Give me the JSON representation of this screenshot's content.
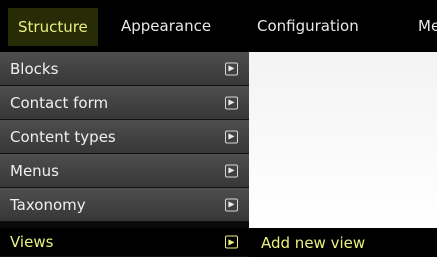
{
  "topnav": {
    "tabs": [
      {
        "label": "Structure"
      },
      {
        "label": "Appearance"
      },
      {
        "label": "Configuration"
      },
      {
        "label": "Me"
      }
    ]
  },
  "structure_menu": {
    "items": [
      {
        "label": "Blocks"
      },
      {
        "label": "Contact form"
      },
      {
        "label": "Content types"
      },
      {
        "label": "Menus"
      },
      {
        "label": "Taxonomy"
      },
      {
        "label": "Views"
      }
    ],
    "active_item": "Views"
  },
  "submenu": {
    "items": [
      {
        "label": "Add new view"
      }
    ]
  },
  "colors": {
    "active_text": "#e9f07f",
    "bar_background": "#000000"
  },
  "icons": {
    "expand": "arrow-right-icon"
  }
}
